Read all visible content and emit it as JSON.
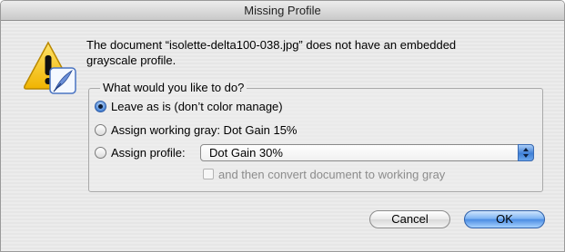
{
  "window": {
    "title": "Missing Profile"
  },
  "message": {
    "line1": "The document “isolette-delta100-038.jpg” does not have an embedded",
    "line2": "grayscale profile."
  },
  "options": {
    "legend": "What would you like to do?",
    "leave_as_is": "Leave as is (don’t color manage)",
    "assign_working_gray": "Assign working gray:  Dot Gain 15%",
    "assign_profile": "Assign profile:",
    "profile_select_value": "Dot Gain 30%",
    "convert_checkbox": "and then convert document to working gray",
    "selected": "leave_as_is"
  },
  "buttons": {
    "cancel": "Cancel",
    "ok": "OK"
  },
  "colors": {
    "accent": "#4c8de3",
    "warning": "#f7c51b"
  },
  "icons": {
    "alert": "warning-triangle-icon",
    "badge": "feather-icon"
  }
}
